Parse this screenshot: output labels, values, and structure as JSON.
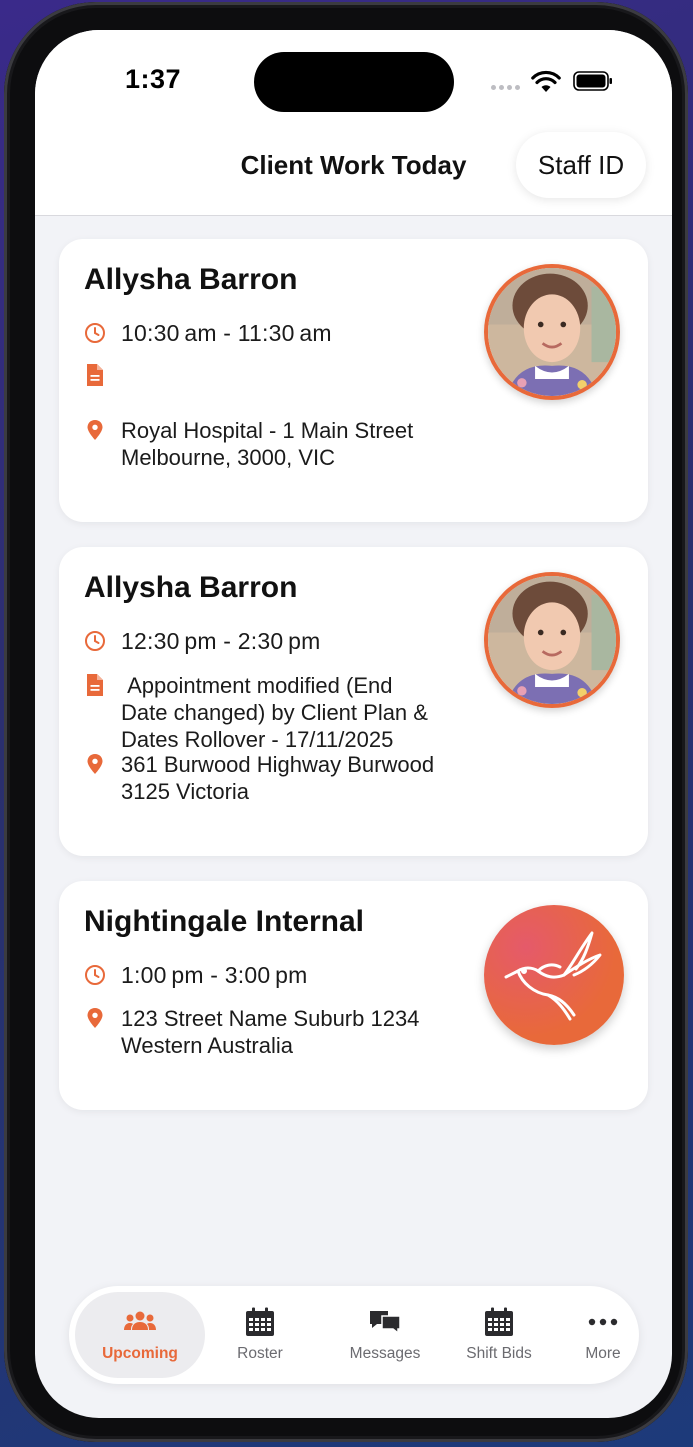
{
  "status_bar": {
    "time": "1:37"
  },
  "header": {
    "title": "Client Work Today",
    "staff_button": "Staff ID"
  },
  "appointments": [
    {
      "client": "Allysha Barron",
      "time": "10:30 am - 11:30 am",
      "note": "",
      "address": [
        "Royal Hospital - 1 Main Street",
        "Melbourne, 3000, VIC"
      ],
      "avatar": "child-photo"
    },
    {
      "client": "Allysha Barron",
      "time": "12:30 pm - 2:30 pm",
      "note": [
        " Appointment modified (End",
        "Date changed) by Client Plan &",
        "Dates Rollover - 17/11/2025"
      ],
      "address": [
        "361 Burwood Highway Burwood",
        "3125 Victoria"
      ],
      "avatar": "child-photo"
    },
    {
      "client": "Nightingale Internal",
      "time": "1:00 pm - 3:00 pm",
      "address": [
        "123 Street Name Suburb 1234",
        "Western Australia"
      ],
      "avatar": "nightingale-bird-logo"
    }
  ],
  "tab_bar": {
    "items": [
      {
        "label": "Upcoming",
        "icon": "people-icon",
        "active": true
      },
      {
        "label": "Roster",
        "icon": "calendar-icon",
        "active": false
      },
      {
        "label": "Messages",
        "icon": "chat-bubbles-icon",
        "active": false
      },
      {
        "label": "Shift Bids",
        "icon": "calendar-icon",
        "active": false
      },
      {
        "label": "More",
        "icon": "more-dots-icon",
        "active": false
      }
    ]
  },
  "colors": {
    "accent": "#e8693a",
    "background": "#f2f3f7",
    "card": "#ffffff"
  }
}
